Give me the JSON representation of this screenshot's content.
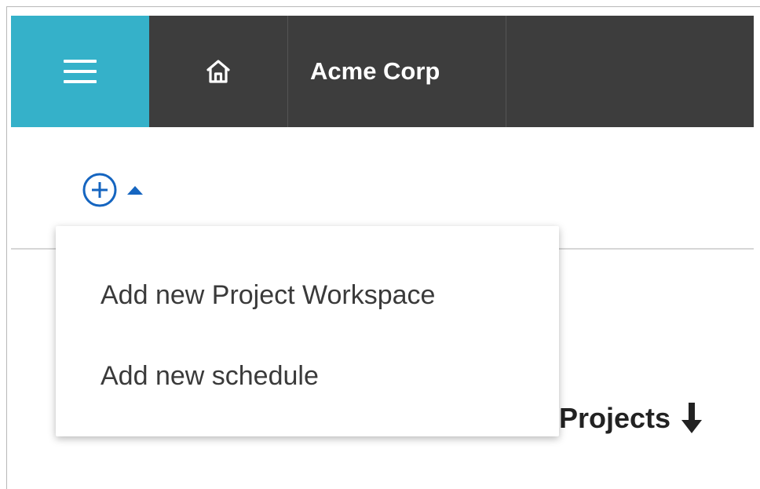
{
  "header": {
    "org_name": "Acme Corp",
    "menu_icon": "hamburger-menu-icon",
    "home_icon": "home-icon",
    "colors": {
      "bar": "#3d3d3d",
      "menu": "#35b1c9"
    }
  },
  "toolbar": {
    "add_icon": "plus-circle-icon",
    "caret_icon": "caret-up-icon",
    "accent": "#1565c0"
  },
  "dropdown_menu": {
    "items": [
      {
        "label": "Add new Project Workspace"
      },
      {
        "label": "Add new schedule"
      }
    ]
  },
  "main": {
    "heading": "Projects",
    "sort_icon": "arrow-down-icon"
  }
}
